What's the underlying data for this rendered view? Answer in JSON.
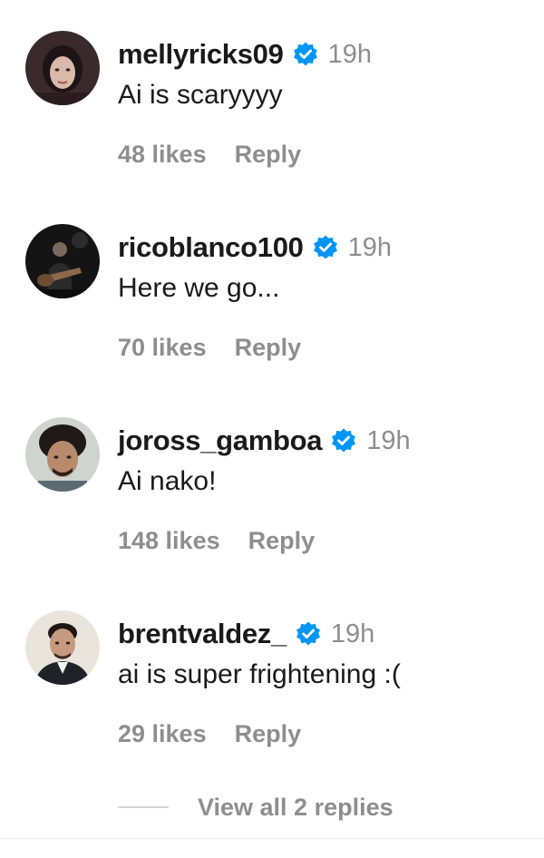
{
  "comments": [
    {
      "username": "mellyricks09",
      "time": "19h",
      "text": "Ai is scaryyyy",
      "likes": "48 likes",
      "reply": "Reply"
    },
    {
      "username": "ricoblanco100",
      "time": "19h",
      "text": "Here we go...",
      "likes": "70 likes",
      "reply": "Reply"
    },
    {
      "username": "joross_gamboa",
      "time": "19h",
      "text": "Ai nako!",
      "likes": "148 likes",
      "reply": "Reply"
    },
    {
      "username": "brentvaldez_",
      "time": "19h",
      "text": "ai is super frightening :(",
      "likes": "29 likes",
      "reply": "Reply"
    }
  ],
  "view_replies": "View all 2 replies",
  "colors": {
    "verified_badge": "#0095f6",
    "secondary_text": "#8e8e8e",
    "primary_text": "#1a1a1a"
  }
}
